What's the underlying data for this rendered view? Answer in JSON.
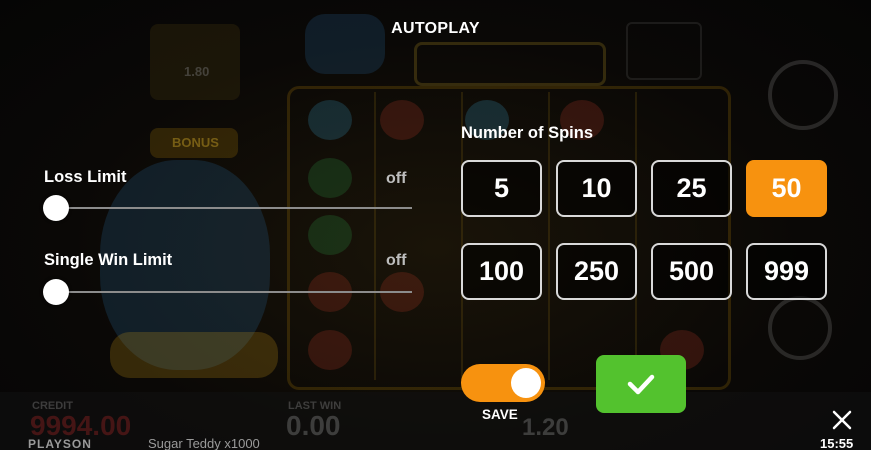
{
  "title": "AUTOPLAY",
  "loss_limit": {
    "label": "Loss Limit",
    "value": "off",
    "level": 0
  },
  "single_win_limit": {
    "label": "Single Win Limit",
    "value": "off",
    "level": 0
  },
  "spins": {
    "heading": "Number of Spins",
    "options": [
      "5",
      "10",
      "25",
      "50",
      "100",
      "250",
      "500",
      "999"
    ],
    "selected": "50"
  },
  "save": {
    "label": "SAVE",
    "enabled": true
  },
  "confirm": {
    "icon": "checkmark-icon"
  },
  "close": {
    "icon": "close-icon"
  },
  "footer": {
    "brand": "PLAYSON",
    "game_name": "Sugar Teddy x1000",
    "time": "15:55"
  },
  "background": {
    "credit_label": "CREDIT",
    "credit_value": "9994.00",
    "last_win_label": "LAST WIN",
    "last_win_value": "0.00",
    "bet_value": "1.20",
    "bonus_label": "BONUS",
    "promo_value": "1.80"
  },
  "colors": {
    "accent": "#f7920f",
    "confirm": "#53c22e"
  }
}
